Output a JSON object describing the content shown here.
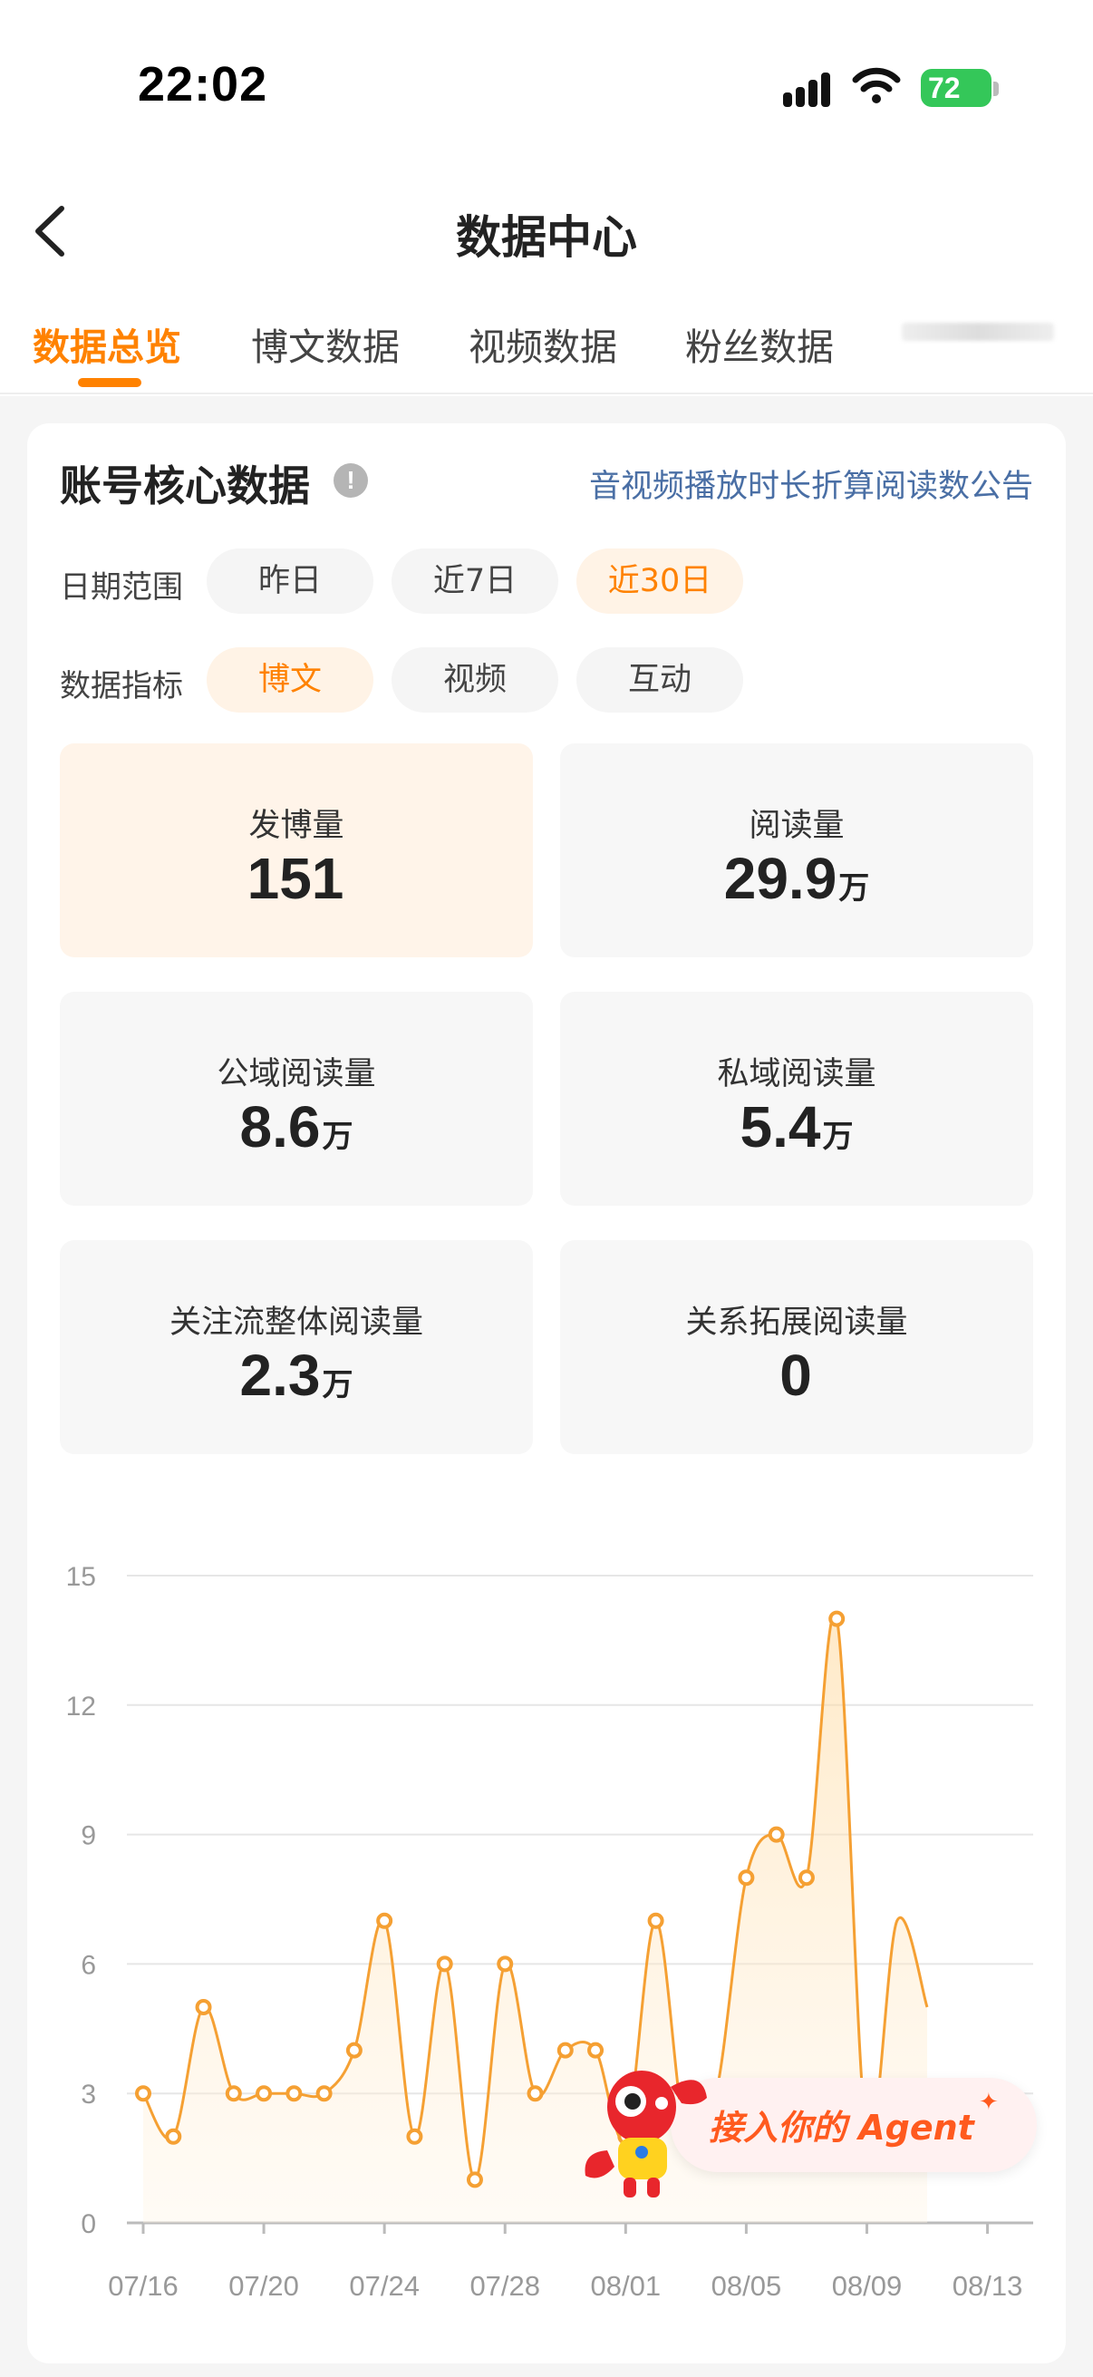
{
  "status_bar": {
    "time": "22:02",
    "battery": "72"
  },
  "nav": {
    "title": "数据中心",
    "back_icon": "chevron-left-icon"
  },
  "tabs": [
    {
      "label": "数据总览",
      "active": true
    },
    {
      "label": "博文数据",
      "active": false
    },
    {
      "label": "视频数据",
      "active": false
    },
    {
      "label": "粉丝数据",
      "active": false
    }
  ],
  "core": {
    "title": "账号核心数据",
    "info_icon": "info-icon",
    "notice": "音视频播放时长折算阅读数公告",
    "date_label": "日期范围",
    "date_options": [
      {
        "label": "昨日",
        "active": false
      },
      {
        "label": "近7日",
        "active": false
      },
      {
        "label": "近30日",
        "active": true
      }
    ],
    "metric_label": "数据指标",
    "metric_options": [
      {
        "label": "博文",
        "active": true
      },
      {
        "label": "视频",
        "active": false
      },
      {
        "label": "互动",
        "active": false
      }
    ],
    "metrics": [
      {
        "label": "发博量",
        "value": "151",
        "unit": "",
        "active": true
      },
      {
        "label": "阅读量",
        "value": "29.9",
        "unit": "万",
        "active": false
      },
      {
        "label": "公域阅读量",
        "value": "8.6",
        "unit": "万",
        "active": false
      },
      {
        "label": "私域阅读量",
        "value": "5.4",
        "unit": "万",
        "active": false
      },
      {
        "label": "关注流整体阅读量",
        "value": "2.3",
        "unit": "万",
        "active": false
      },
      {
        "label": "关系拓展阅读量",
        "value": "0",
        "unit": "",
        "active": false
      }
    ]
  },
  "chart_data": {
    "type": "area",
    "title": "",
    "xlabel": "",
    "ylabel": "",
    "ylim": [
      0,
      15
    ],
    "y_ticks": [
      0,
      3,
      6,
      9,
      12,
      15
    ],
    "x_tick_labels": [
      "07/16",
      "07/20",
      "07/24",
      "07/28",
      "08/01",
      "08/05",
      "08/09",
      "08/13"
    ],
    "x": [
      "07/16",
      "07/17",
      "07/18",
      "07/19",
      "07/20",
      "07/21",
      "07/22",
      "07/23",
      "07/24",
      "07/25",
      "07/26",
      "07/27",
      "07/28",
      "07/29",
      "07/30",
      "07/31",
      "08/01",
      "08/02",
      "08/03",
      "08/04",
      "08/05",
      "08/06",
      "08/07",
      "08/08",
      "08/09",
      "08/10",
      "08/11"
    ],
    "series": [
      {
        "values": [
          3,
          2,
          5,
          3,
          3,
          3,
          3,
          4,
          7,
          2,
          6,
          1,
          6,
          3,
          4,
          4,
          2,
          7,
          2,
          3,
          8,
          9,
          8,
          14,
          2,
          7,
          5
        ]
      }
    ],
    "hidden_markers_after_index": 23,
    "grid": true,
    "line_color": "#f5a033"
  },
  "agent_banner": {
    "text": "接入你的 Agent",
    "sparkle_icon": "sparkle-icon",
    "mascot_icon": "crayfish-mascot-icon"
  }
}
